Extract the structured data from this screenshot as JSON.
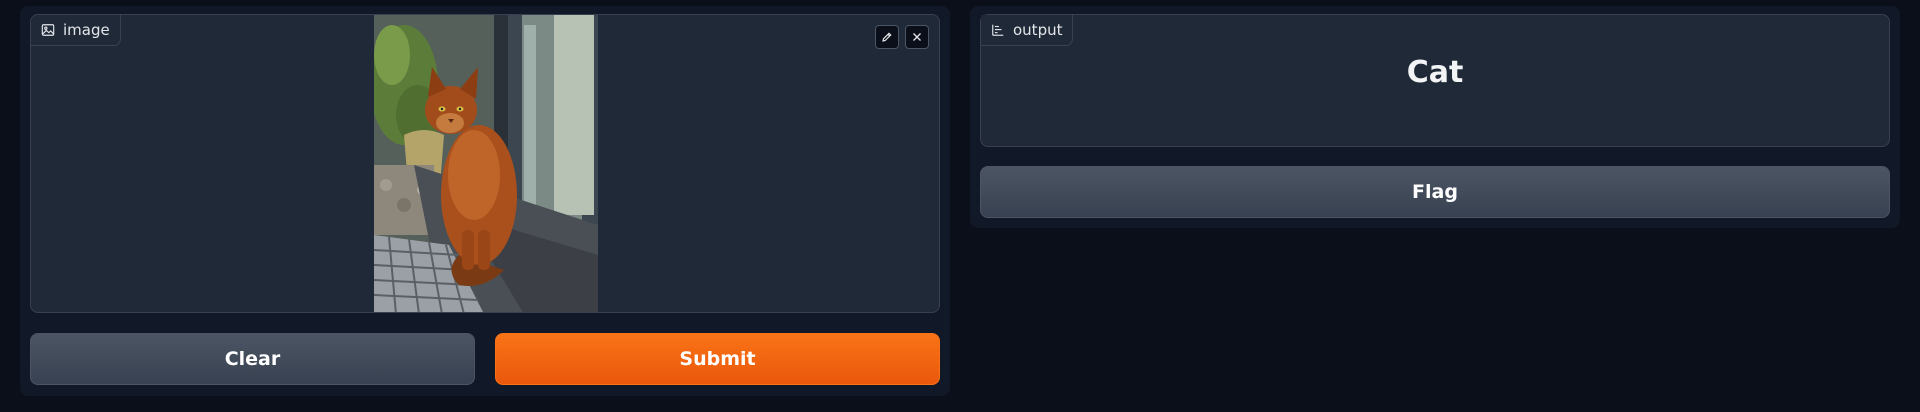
{
  "input": {
    "label": "image",
    "label_icon": "image-icon",
    "edit_icon": "pencil-icon",
    "close_icon": "close-icon"
  },
  "actions": {
    "clear_label": "Clear",
    "submit_label": "Submit"
  },
  "output": {
    "label": "output",
    "label_icon": "chart-icon",
    "value": "Cat",
    "flag_label": "Flag"
  },
  "colors": {
    "background": "#0b0f19",
    "panel": "#111827",
    "block": "#1f2937",
    "border": "#374151",
    "primary": "#f97316",
    "secondary": "#4b5563"
  }
}
